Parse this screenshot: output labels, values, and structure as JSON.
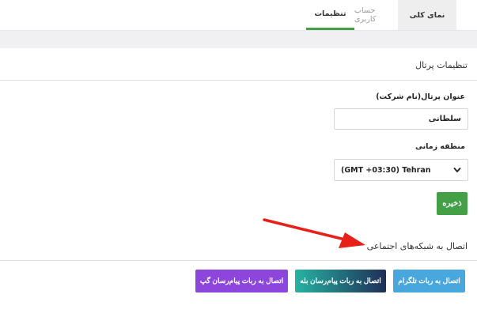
{
  "tabs": [
    {
      "label": "نمای کلی"
    },
    {
      "label": "حساب کاربری"
    },
    {
      "label": "تنظیمات"
    }
  ],
  "portal_settings": {
    "title": "تنظیمات پرتال",
    "company_label": "عنوان پرتال(نام شرکت)",
    "company_value": "سلطانی",
    "timezone_label": "منطقه زمانی",
    "timezone_value": "(GMT +03:30) Tehran",
    "save_label": "ذخیره"
  },
  "social": {
    "title": "اتصال به شبکه‌های اجتماعی",
    "telegram_label": "اتصال به ربات تلگرام",
    "bale_label": "اتصال به ربات پیام‌رسان بله",
    "gap_label": "اتصال به ربات پیام‌رسان گپ"
  },
  "colors": {
    "accent_green": "#43a047",
    "telegram_blue": "#48a7dc",
    "gap_purple": "#8c46dc",
    "arrow_red": "#e8201a"
  }
}
